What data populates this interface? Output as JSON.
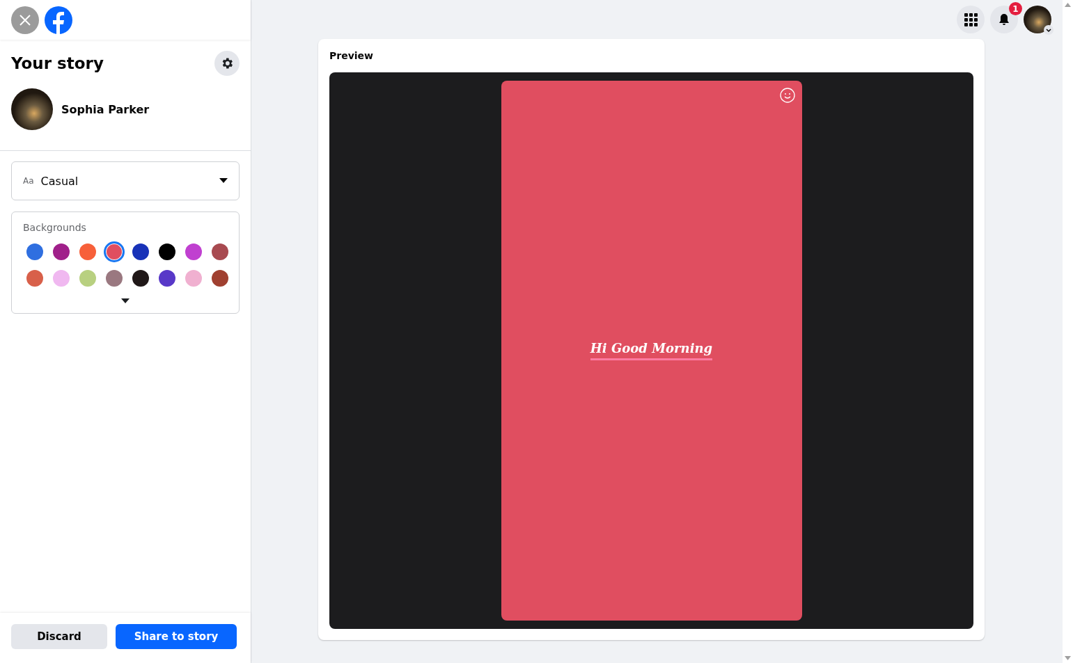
{
  "sidebar": {
    "title": "Your story",
    "user": {
      "name": "Sophia Parker"
    },
    "font_select": {
      "prefix": "Aa",
      "value": "Casual"
    },
    "backgrounds": {
      "label": "Backgrounds",
      "swatches": [
        {
          "color": "#2f6fe0",
          "selected": false
        },
        {
          "color": "#a0208a",
          "selected": false
        },
        {
          "color": "#f7603a",
          "selected": false
        },
        {
          "color": "#e04e60",
          "selected": true
        },
        {
          "color": "#1832b8",
          "selected": false
        },
        {
          "color": "#000000",
          "selected": false
        },
        {
          "color": "#c040d0",
          "selected": false
        },
        {
          "color": "#a84a50",
          "selected": false
        },
        {
          "color": "#d8604a",
          "selected": false
        },
        {
          "color": "#f0b8f0",
          "selected": false
        },
        {
          "color": "#b8d080",
          "selected": false
        },
        {
          "color": "#9a7880",
          "selected": false
        },
        {
          "color": "#201818",
          "selected": false
        },
        {
          "color": "#5838c8",
          "selected": false
        },
        {
          "color": "#f0b0d0",
          "selected": false
        },
        {
          "color": "#a04030",
          "selected": false
        }
      ]
    },
    "buttons": [
      {
        "label": "Discard",
        "kind": "secondary"
      },
      {
        "label": "Share to story",
        "kind": "primary"
      }
    ]
  },
  "header": {
    "notification_count": "1"
  },
  "preview": {
    "title": "Preview",
    "story_text": "Hi Good Morning"
  }
}
